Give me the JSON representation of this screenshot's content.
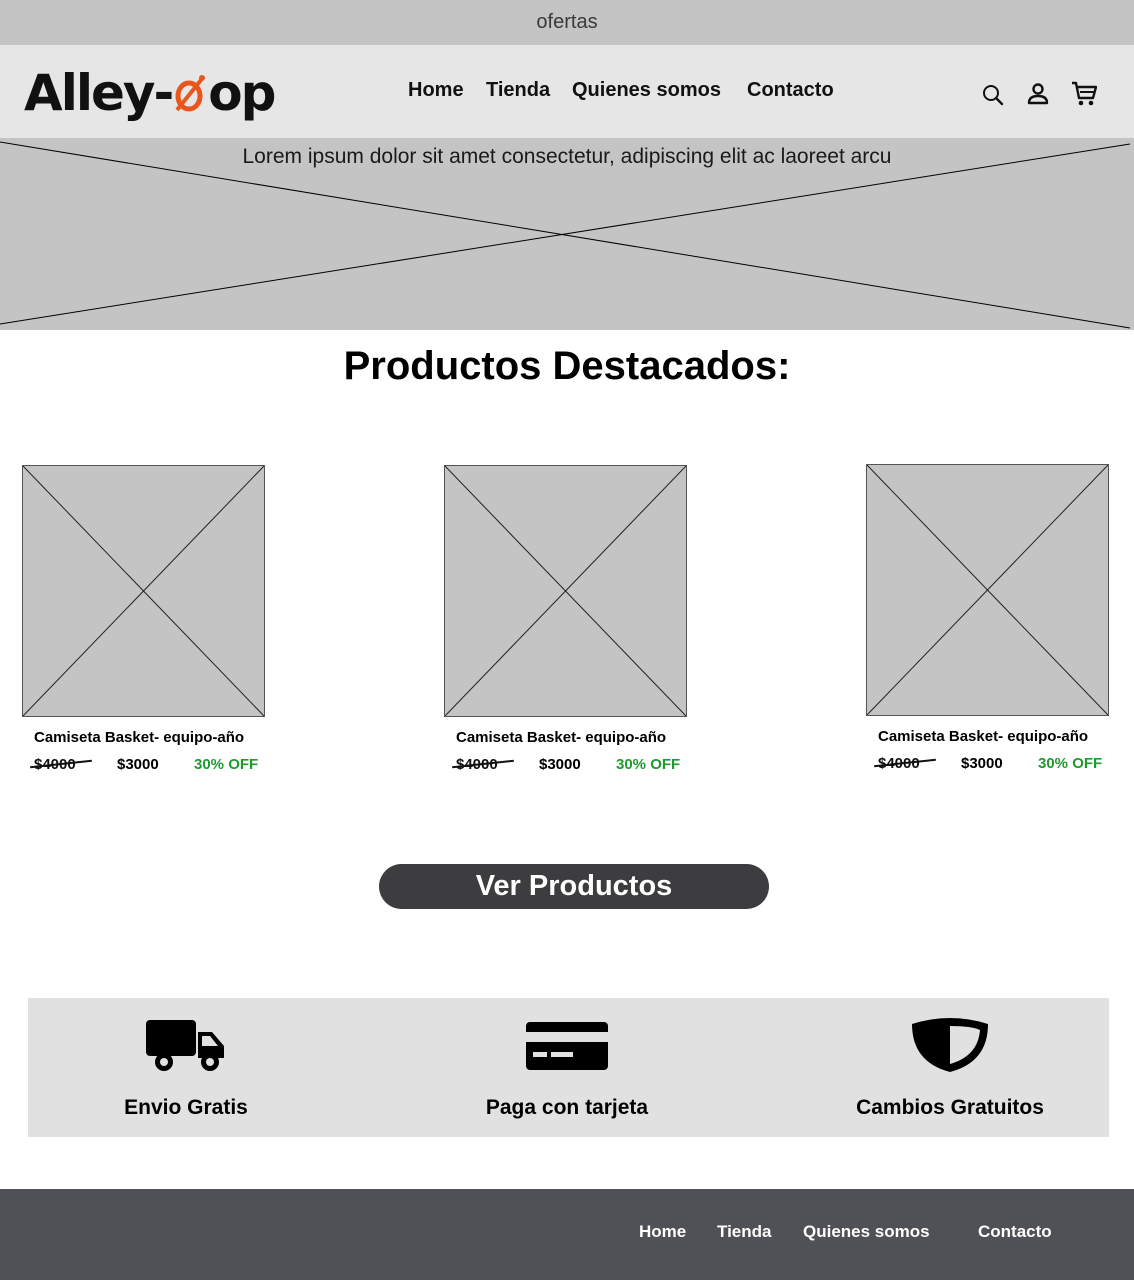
{
  "top_bar": {
    "text": "ofertas"
  },
  "header": {
    "logo": {
      "part1": "Alley-",
      "part2": "op",
      "accent_color": "#e8561e"
    },
    "nav": [
      {
        "label": "Home"
      },
      {
        "label": "Tienda"
      },
      {
        "label": "Quienes somos"
      },
      {
        "label": "Contacto"
      }
    ],
    "icons": [
      "search-icon",
      "user-icon",
      "cart-icon"
    ]
  },
  "hero": {
    "text": "Lorem ipsum dolor sit amet consectetur, adipiscing elit ac laoreet arcu"
  },
  "featured": {
    "title": "Productos Destacados:",
    "products": [
      {
        "name": "Camiseta Basket- equipo-año",
        "old_price": "$4000",
        "price": "$3000",
        "discount": "30% OFF"
      },
      {
        "name": "Camiseta Basket- equipo-año",
        "old_price": "$4000",
        "price": "$3000",
        "discount": "30% OFF"
      },
      {
        "name": "Camiseta Basket- equipo-año",
        "old_price": "$4000",
        "price": "$3000",
        "discount": "30% OFF"
      }
    ],
    "discount_color": "#1e9a2e"
  },
  "cta": {
    "label": "Ver Productos"
  },
  "features": [
    {
      "icon": "truck-icon",
      "label": "Envio Gratis"
    },
    {
      "icon": "credit-card-icon",
      "label": "Paga con tarjeta"
    },
    {
      "icon": "shield-icon",
      "label": "Cambios Gratuitos"
    }
  ],
  "footer": {
    "nav": [
      {
        "label": "Home"
      },
      {
        "label": "Tienda"
      },
      {
        "label": "Quienes somos"
      },
      {
        "label": "Contacto"
      }
    ]
  }
}
